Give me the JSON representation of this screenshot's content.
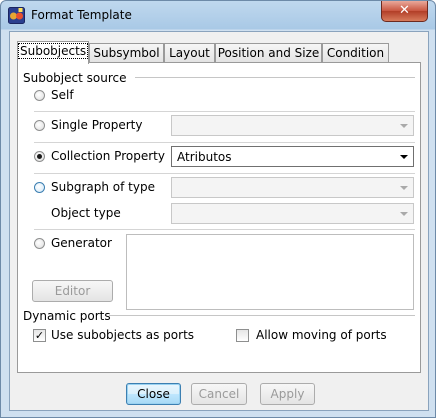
{
  "window": {
    "title": "Format Template",
    "close_glyph": "✕"
  },
  "tabs": [
    {
      "label": "Subobjects",
      "active": true
    },
    {
      "label": "Subsymbol",
      "active": false
    },
    {
      "label": "Layout",
      "active": false
    },
    {
      "label": "Position and Size",
      "active": false
    },
    {
      "label": "Condition",
      "active": false
    }
  ],
  "subobject_source": {
    "heading": "Subobject source",
    "self": {
      "label": "Self",
      "selected": false
    },
    "single_property": {
      "label": "Single Property",
      "selected": false,
      "value": ""
    },
    "collection_property": {
      "label": "Collection Property",
      "selected": true,
      "value": "Atributos"
    },
    "subgraph_of_type": {
      "label": "Subgraph of type",
      "selected": false,
      "value": ""
    },
    "object_type": {
      "label": "Object type",
      "value": ""
    },
    "generator": {
      "label": "Generator",
      "selected": false,
      "text": ""
    },
    "editor_button": "Editor"
  },
  "dynamic_ports": {
    "heading": "Dynamic ports",
    "use_subobjects": {
      "label": "Use subobjects as ports",
      "checked": true
    },
    "allow_moving": {
      "label": "Allow moving of ports",
      "checked": false
    }
  },
  "buttons": {
    "close": "Close",
    "cancel": "Cancel",
    "apply": "Apply"
  },
  "colors": {
    "accent": "#3c7fb1",
    "titlebar": "#a9c9e6",
    "close_button": "#c8553f"
  },
  "icons": {
    "app": "app-icon",
    "close": "close-icon",
    "dropdown": "chevron-down-icon",
    "check": "checkmark-icon"
  }
}
